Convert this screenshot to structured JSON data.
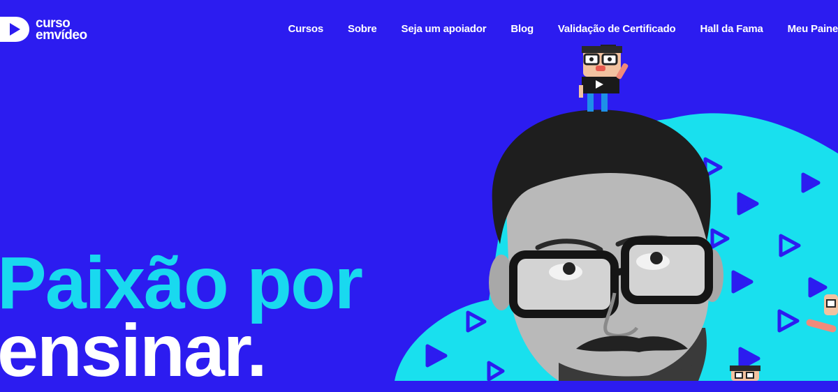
{
  "brand": {
    "line1": "curso",
    "line2": "emvídeo"
  },
  "nav": {
    "items": [
      {
        "label": "Cursos"
      },
      {
        "label": "Sobre"
      },
      {
        "label": "Seja um apoiador"
      },
      {
        "label": "Blog"
      },
      {
        "label": "Validação de Certificado"
      },
      {
        "label": "Hall da Fama"
      },
      {
        "label": "Meu Painel"
      }
    ]
  },
  "hero": {
    "line1": "Paixão por",
    "line2": "ensinar."
  },
  "colors": {
    "background": "#2c1cf0",
    "accent_cyan": "#19d9ef",
    "text_white": "#ffffff"
  },
  "icons": [
    "play-logo-icon",
    "play-triangle-icon",
    "mascot-character",
    "teacher-photo"
  ]
}
